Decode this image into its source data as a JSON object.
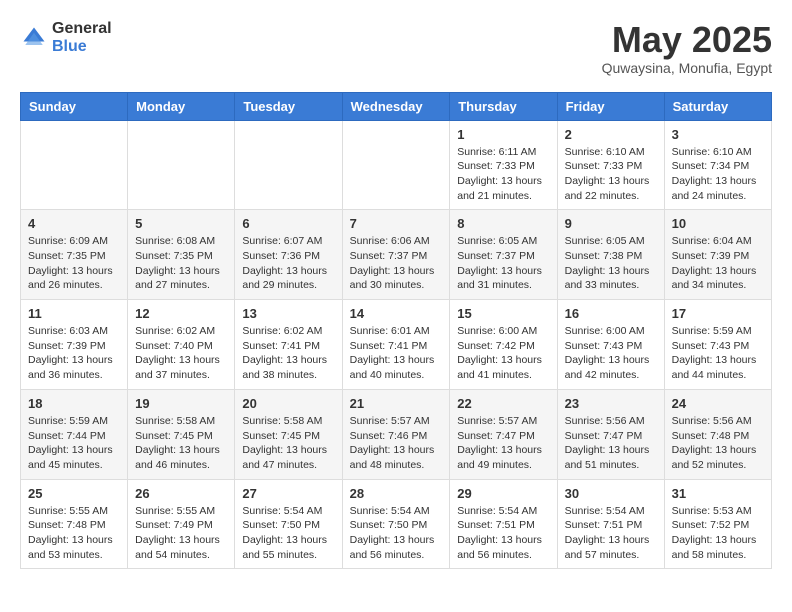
{
  "logo": {
    "general": "General",
    "blue": "Blue"
  },
  "title": {
    "month_year": "May 2025",
    "location": "Quwaysina, Monufia, Egypt"
  },
  "weekdays": [
    "Sunday",
    "Monday",
    "Tuesday",
    "Wednesday",
    "Thursday",
    "Friday",
    "Saturday"
  ],
  "weeks": [
    [
      {
        "day": "",
        "info": ""
      },
      {
        "day": "",
        "info": ""
      },
      {
        "day": "",
        "info": ""
      },
      {
        "day": "",
        "info": ""
      },
      {
        "day": "1",
        "info": "Sunrise: 6:11 AM\nSunset: 7:33 PM\nDaylight: 13 hours\nand 21 minutes."
      },
      {
        "day": "2",
        "info": "Sunrise: 6:10 AM\nSunset: 7:33 PM\nDaylight: 13 hours\nand 22 minutes."
      },
      {
        "day": "3",
        "info": "Sunrise: 6:10 AM\nSunset: 7:34 PM\nDaylight: 13 hours\nand 24 minutes."
      }
    ],
    [
      {
        "day": "4",
        "info": "Sunrise: 6:09 AM\nSunset: 7:35 PM\nDaylight: 13 hours\nand 26 minutes."
      },
      {
        "day": "5",
        "info": "Sunrise: 6:08 AM\nSunset: 7:35 PM\nDaylight: 13 hours\nand 27 minutes."
      },
      {
        "day": "6",
        "info": "Sunrise: 6:07 AM\nSunset: 7:36 PM\nDaylight: 13 hours\nand 29 minutes."
      },
      {
        "day": "7",
        "info": "Sunrise: 6:06 AM\nSunset: 7:37 PM\nDaylight: 13 hours\nand 30 minutes."
      },
      {
        "day": "8",
        "info": "Sunrise: 6:05 AM\nSunset: 7:37 PM\nDaylight: 13 hours\nand 31 minutes."
      },
      {
        "day": "9",
        "info": "Sunrise: 6:05 AM\nSunset: 7:38 PM\nDaylight: 13 hours\nand 33 minutes."
      },
      {
        "day": "10",
        "info": "Sunrise: 6:04 AM\nSunset: 7:39 PM\nDaylight: 13 hours\nand 34 minutes."
      }
    ],
    [
      {
        "day": "11",
        "info": "Sunrise: 6:03 AM\nSunset: 7:39 PM\nDaylight: 13 hours\nand 36 minutes."
      },
      {
        "day": "12",
        "info": "Sunrise: 6:02 AM\nSunset: 7:40 PM\nDaylight: 13 hours\nand 37 minutes."
      },
      {
        "day": "13",
        "info": "Sunrise: 6:02 AM\nSunset: 7:41 PM\nDaylight: 13 hours\nand 38 minutes."
      },
      {
        "day": "14",
        "info": "Sunrise: 6:01 AM\nSunset: 7:41 PM\nDaylight: 13 hours\nand 40 minutes."
      },
      {
        "day": "15",
        "info": "Sunrise: 6:00 AM\nSunset: 7:42 PM\nDaylight: 13 hours\nand 41 minutes."
      },
      {
        "day": "16",
        "info": "Sunrise: 6:00 AM\nSunset: 7:43 PM\nDaylight: 13 hours\nand 42 minutes."
      },
      {
        "day": "17",
        "info": "Sunrise: 5:59 AM\nSunset: 7:43 PM\nDaylight: 13 hours\nand 44 minutes."
      }
    ],
    [
      {
        "day": "18",
        "info": "Sunrise: 5:59 AM\nSunset: 7:44 PM\nDaylight: 13 hours\nand 45 minutes."
      },
      {
        "day": "19",
        "info": "Sunrise: 5:58 AM\nSunset: 7:45 PM\nDaylight: 13 hours\nand 46 minutes."
      },
      {
        "day": "20",
        "info": "Sunrise: 5:58 AM\nSunset: 7:45 PM\nDaylight: 13 hours\nand 47 minutes."
      },
      {
        "day": "21",
        "info": "Sunrise: 5:57 AM\nSunset: 7:46 PM\nDaylight: 13 hours\nand 48 minutes."
      },
      {
        "day": "22",
        "info": "Sunrise: 5:57 AM\nSunset: 7:47 PM\nDaylight: 13 hours\nand 49 minutes."
      },
      {
        "day": "23",
        "info": "Sunrise: 5:56 AM\nSunset: 7:47 PM\nDaylight: 13 hours\nand 51 minutes."
      },
      {
        "day": "24",
        "info": "Sunrise: 5:56 AM\nSunset: 7:48 PM\nDaylight: 13 hours\nand 52 minutes."
      }
    ],
    [
      {
        "day": "25",
        "info": "Sunrise: 5:55 AM\nSunset: 7:48 PM\nDaylight: 13 hours\nand 53 minutes."
      },
      {
        "day": "26",
        "info": "Sunrise: 5:55 AM\nSunset: 7:49 PM\nDaylight: 13 hours\nand 54 minutes."
      },
      {
        "day": "27",
        "info": "Sunrise: 5:54 AM\nSunset: 7:50 PM\nDaylight: 13 hours\nand 55 minutes."
      },
      {
        "day": "28",
        "info": "Sunrise: 5:54 AM\nSunset: 7:50 PM\nDaylight: 13 hours\nand 56 minutes."
      },
      {
        "day": "29",
        "info": "Sunrise: 5:54 AM\nSunset: 7:51 PM\nDaylight: 13 hours\nand 56 minutes."
      },
      {
        "day": "30",
        "info": "Sunrise: 5:54 AM\nSunset: 7:51 PM\nDaylight: 13 hours\nand 57 minutes."
      },
      {
        "day": "31",
        "info": "Sunrise: 5:53 AM\nSunset: 7:52 PM\nDaylight: 13 hours\nand 58 minutes."
      }
    ]
  ]
}
